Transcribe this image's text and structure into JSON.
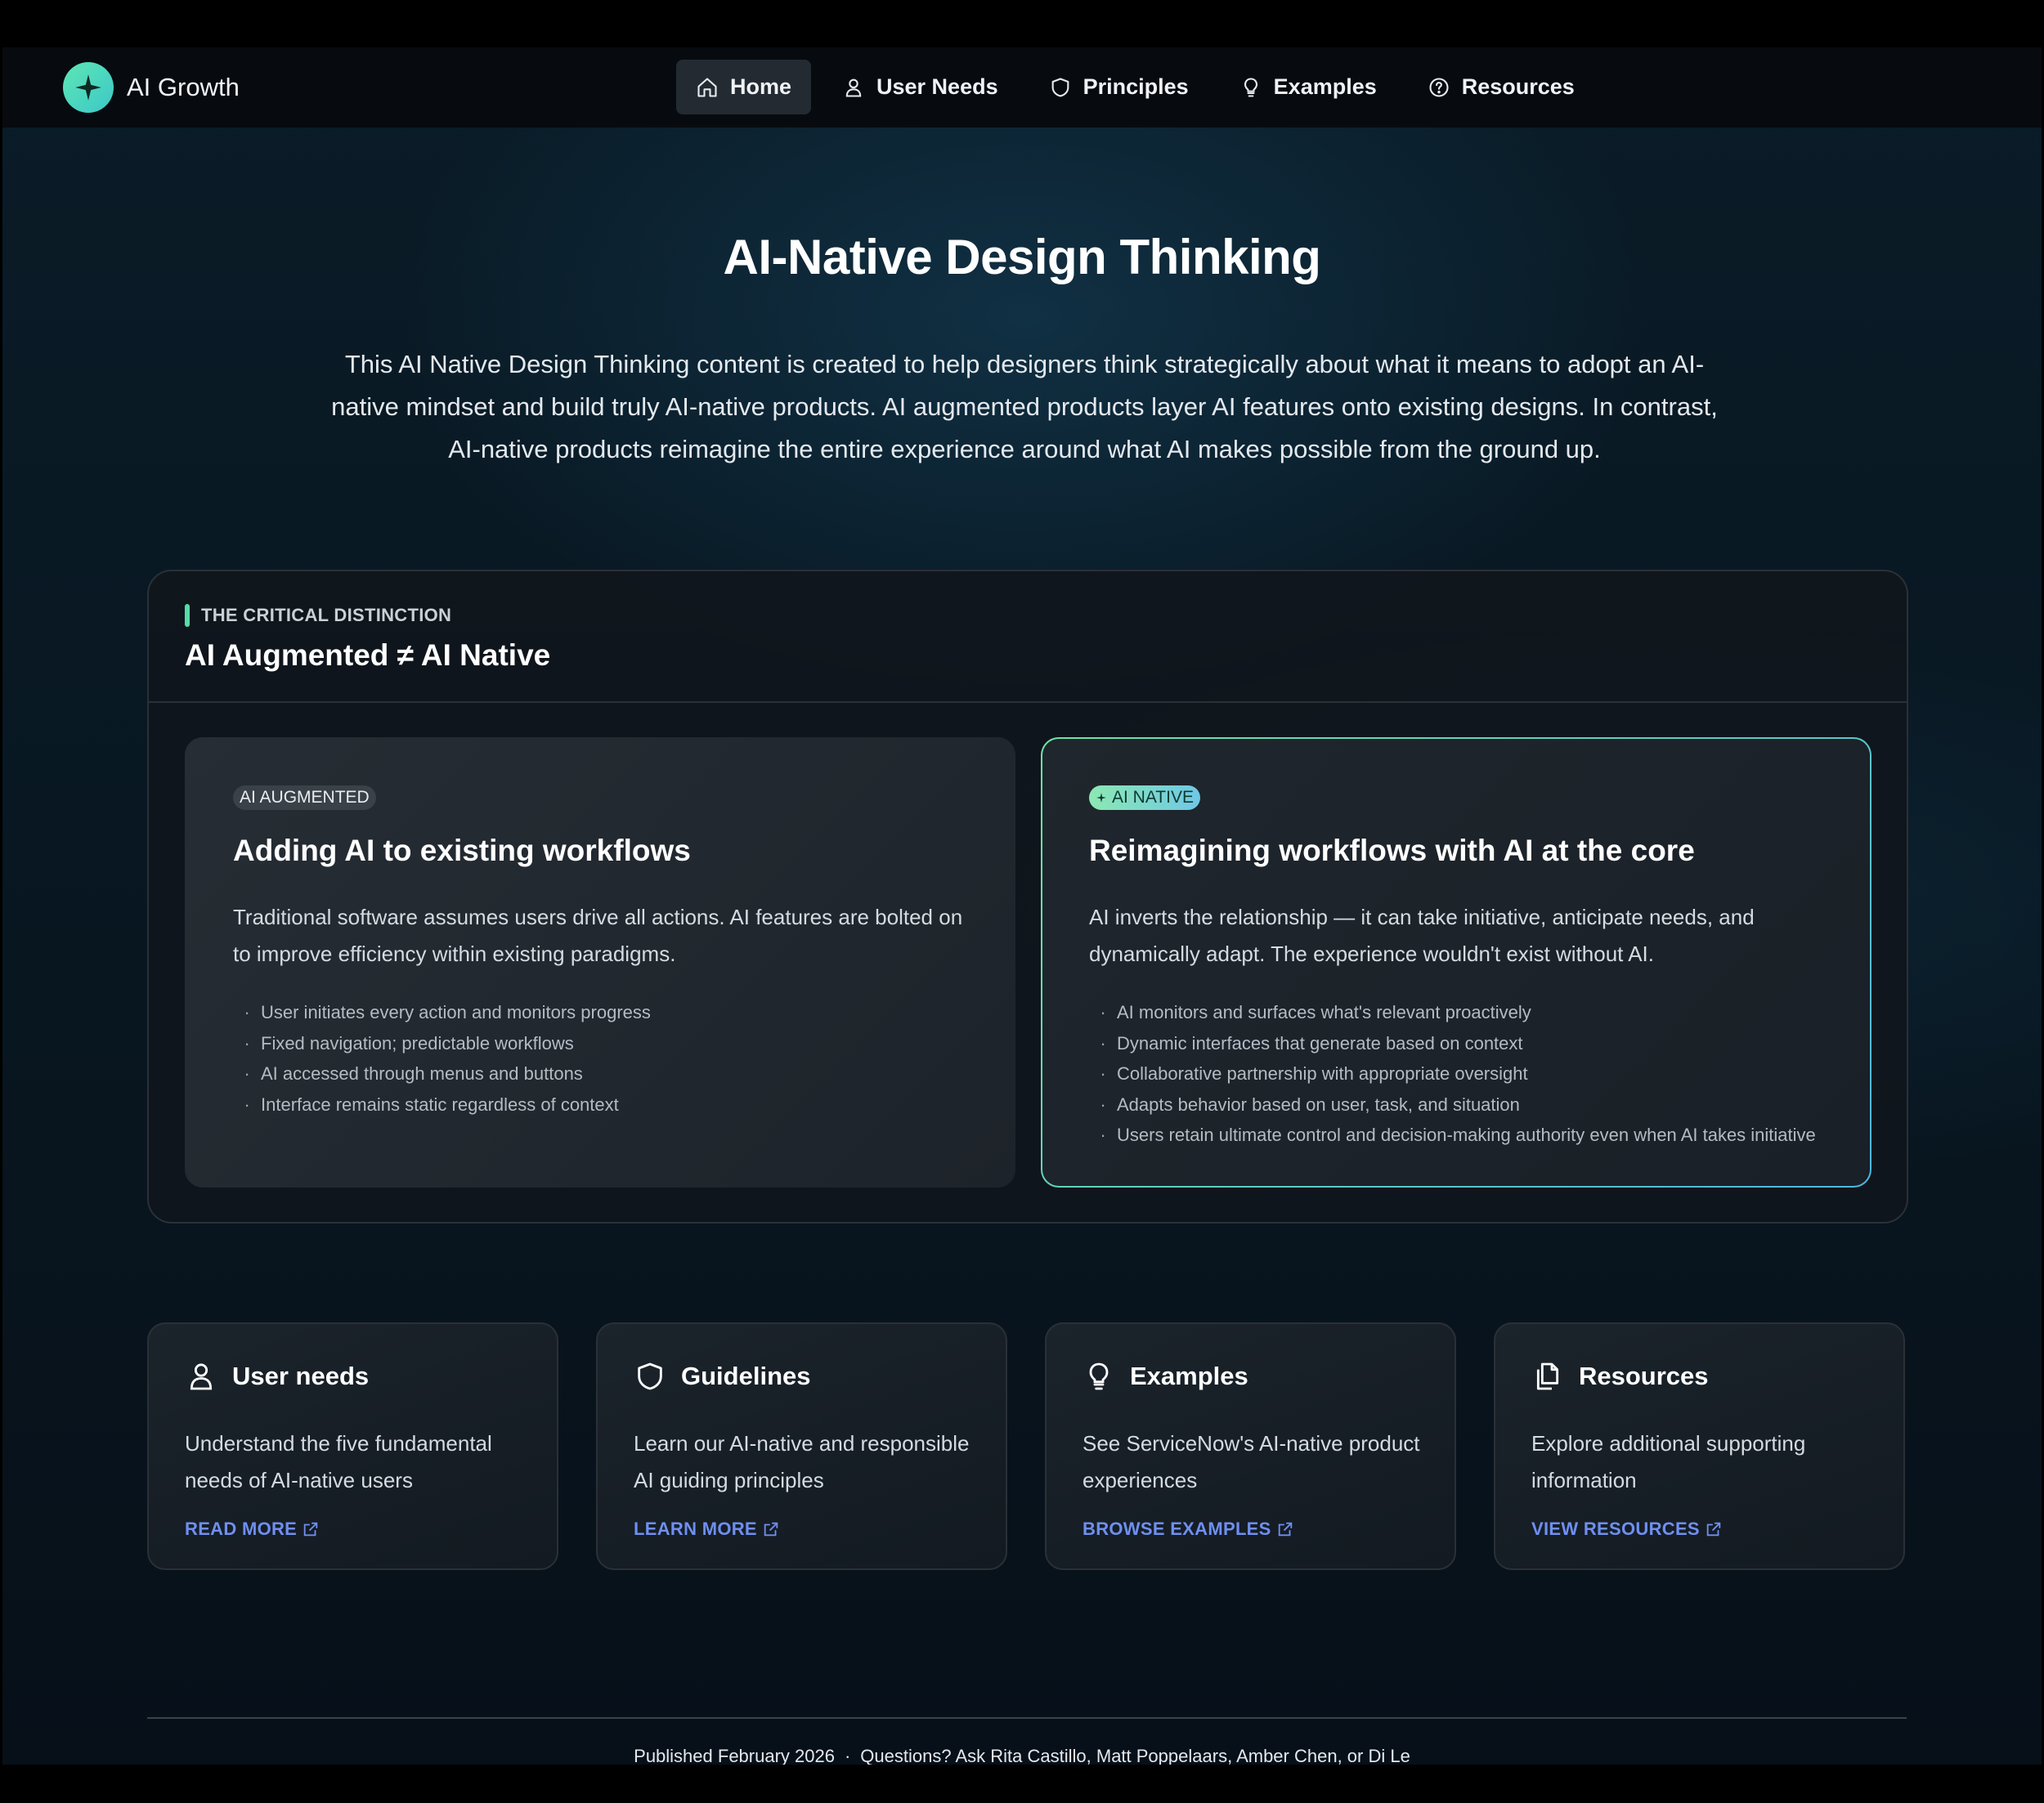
{
  "header": {
    "brand_name": "AI Growth",
    "brand_icon": "sparkle-icon",
    "nav": [
      {
        "label": "Home",
        "icon": "home-icon",
        "active": true
      },
      {
        "label": "User Needs",
        "icon": "user-icon",
        "active": false
      },
      {
        "label": "Principles",
        "icon": "shield-icon",
        "active": false
      },
      {
        "label": "Examples",
        "icon": "lightbulb-icon",
        "active": false
      },
      {
        "label": "Resources",
        "icon": "question-circle-icon",
        "active": false
      }
    ]
  },
  "hero": {
    "title": "AI-Native Design Thinking",
    "description": "This AI Native Design Thinking content is created to help designers think strategically about what it means to adopt an AI-native mindset and build truly AI-native products. AI augmented products layer AI features onto existing designs. In contrast, AI-native products reimagine the entire experience around what AI makes possible from the ground up."
  },
  "distinction": {
    "eyebrow": "THE CRITICAL DISTINCTION",
    "title": "AI Augmented ≠ AI Native",
    "augmented": {
      "badge": "AI AUGMENTED",
      "title": "Adding AI to existing workflows",
      "description": "Traditional software assumes users drive all actions. AI features are bolted on to improve efficiency within existing paradigms.",
      "bullets": [
        "User initiates every action and monitors progress",
        "Fixed navigation; predictable workflows",
        "AI accessed through menus and buttons",
        "Interface remains static regardless of context"
      ]
    },
    "native": {
      "badge": "AI NATIVE",
      "title": "Reimagining workflows with AI at the core",
      "description": "AI inverts the relationship — it can take initiative, anticipate needs, and dynamically adapt. The experience wouldn't exist without AI.",
      "bullets": [
        "AI monitors and surfaces what's relevant proactively",
        "Dynamic interfaces that generate based on context",
        "Collaborative partnership with appropriate oversight",
        "Adapts behavior based on user, task, and situation",
        "Users retain ultimate control and decision-making authority even when AI takes initiative"
      ]
    }
  },
  "cards": [
    {
      "icon": "user-icon",
      "title": "User needs",
      "description": "Understand the five fundamental needs of AI-native users",
      "link": "READ MORE"
    },
    {
      "icon": "shield-icon",
      "title": "Guidelines",
      "description": "Learn our AI-native and responsible AI guiding principles",
      "link": "LEARN MORE"
    },
    {
      "icon": "lightbulb-icon",
      "title": "Examples",
      "description": "See ServiceNow's AI-native product experiences",
      "link": "BROWSE EXAMPLES"
    },
    {
      "icon": "documents-icon",
      "title": "Resources",
      "description": "Explore additional supporting information",
      "link": "VIEW RESOURCES"
    }
  ],
  "footer": {
    "published": "Published February 2026",
    "separator": "·",
    "contact": "Questions? Ask Rita Castillo, Matt Poppelaars, Amber Chen, or Di Le"
  },
  "colors": {
    "accent_green": "#56dca8",
    "link_blue": "#6f8ff0",
    "page_bg": "#0a1c28"
  }
}
